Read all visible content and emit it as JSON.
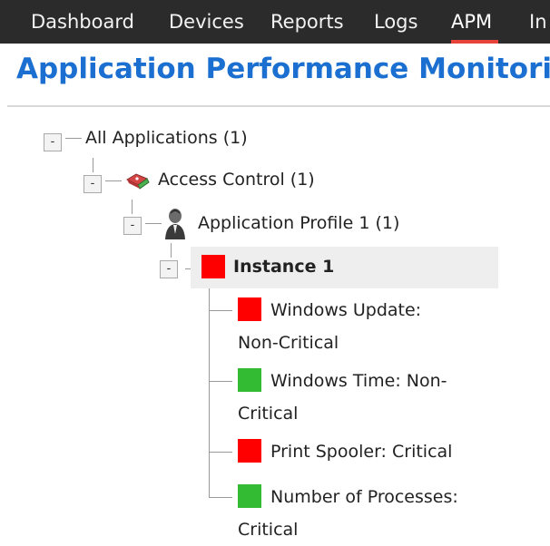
{
  "nav": {
    "items": [
      {
        "label": "Dashboard"
      },
      {
        "label": "Devices"
      },
      {
        "label": "Reports"
      },
      {
        "label": "Logs"
      },
      {
        "label": "APM"
      },
      {
        "label": "In"
      }
    ],
    "active": "APM"
  },
  "page": {
    "title": "Application Performance Monitori"
  },
  "tree": {
    "root": {
      "label": "All Applications (1)",
      "toggle": "-"
    },
    "group": {
      "label": "Access Control (1)",
      "toggle": "-",
      "icon": "access-control-icon"
    },
    "profile": {
      "label": "Application Profile 1 (1)",
      "toggle": "-",
      "icon": "user-profile-icon"
    },
    "instance": {
      "label": "Instance 1",
      "toggle": "-",
      "status_color": "#ff0000"
    },
    "services": [
      {
        "label": "Windows Update: Non-Critical",
        "status_color": "#ff0000"
      },
      {
        "label": "Windows Time: Non-Critical",
        "status_color": "#33bb33"
      },
      {
        "label": "Print Spooler: Critical",
        "status_color": "#ff0000"
      },
      {
        "label": "Number of Processes: Critical",
        "status_color": "#33bb33"
      }
    ]
  },
  "colors": {
    "nav_bg": "#2b2b2b",
    "active_underline": "#e8433a",
    "title": "#1a6fd0",
    "status_red": "#ff0000",
    "status_green": "#33bb33"
  }
}
